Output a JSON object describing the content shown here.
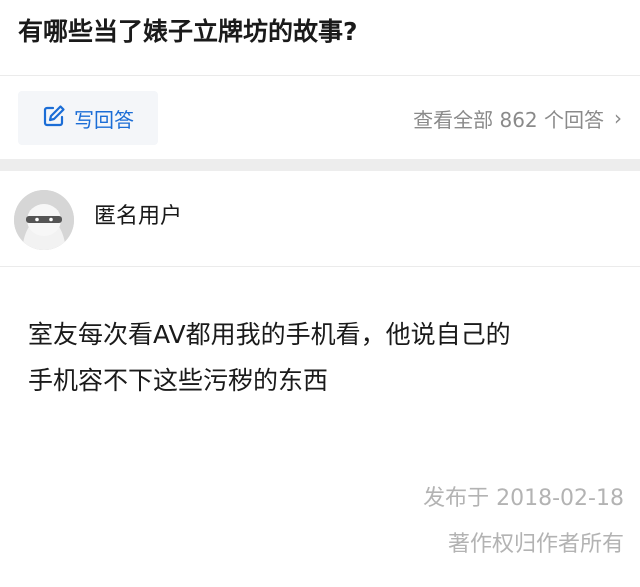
{
  "question": {
    "title": "有哪些当了婊子立牌坊的故事?"
  },
  "actions": {
    "write_answer_label": "写回答",
    "view_all_label": "查看全部 862 个回答",
    "chevron": "›"
  },
  "icons": {
    "write": "pencil-square-icon",
    "chevron": "chevron-right-icon"
  },
  "answer": {
    "author_name": "匿名用户",
    "body_line1": "室友每次看AV都用我的手机看，他说自己的",
    "body_line2": "手机容不下这些污秽的东西",
    "published": "发布于 2018-02-18",
    "copyright": "著作权归作者所有"
  },
  "colors": {
    "accent": "#1b6dd6",
    "muted": "#8a8a8a",
    "meta": "#b3b3b3",
    "divider": "#ededed"
  }
}
